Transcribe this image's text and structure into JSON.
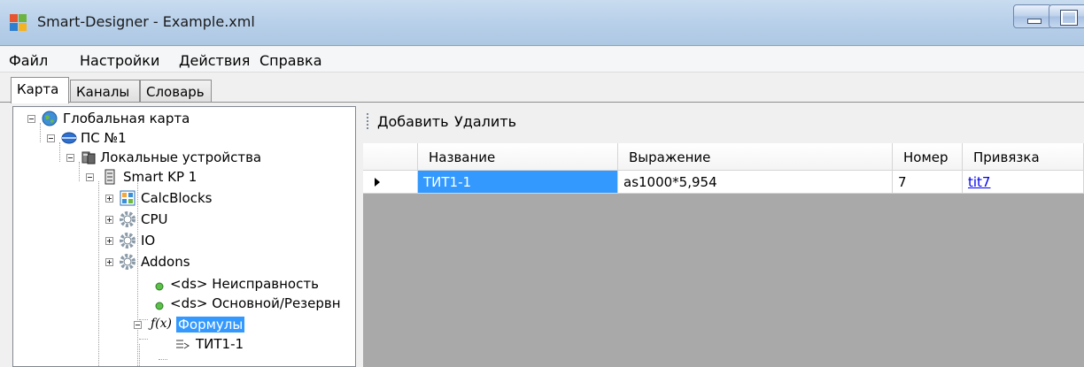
{
  "window": {
    "title": "Smart-Designer - Example.xml"
  },
  "menu": {
    "items": [
      "Файл",
      "Настройки",
      "Действия",
      "Справка"
    ]
  },
  "tabs": [
    "Карта",
    "Каналы",
    "Словарь"
  ],
  "tree": {
    "nodes": [
      {
        "label": "Глобальная карта",
        "icon": "globe-icon"
      },
      {
        "label": "ПС №1",
        "icon": "substation-icon"
      },
      {
        "label": "Локальные устройства",
        "icon": "devices-icon"
      },
      {
        "label": "Smart KP 1",
        "icon": "server-icon"
      },
      {
        "label": "CalcBlocks",
        "icon": "calcblocks-icon"
      },
      {
        "label": "CPU",
        "icon": "gear-icon"
      },
      {
        "label": "IO",
        "icon": "gear-icon"
      },
      {
        "label": "Addons",
        "icon": "gear-icon"
      },
      {
        "label": "<ds> Неисправность",
        "icon": "green-dot-icon"
      },
      {
        "label": "<ds> Основной/Резервн",
        "icon": "green-dot-icon"
      },
      {
        "label": "Формулы",
        "icon": "formula-icon"
      },
      {
        "label": "ТИТ1-1",
        "icon": "formula-item-icon"
      }
    ]
  },
  "toolbar": {
    "add_label": "Добавить",
    "delete_label": "Удалить"
  },
  "grid": {
    "columns": [
      "Название",
      "Выражение",
      "Номер",
      "Привязка"
    ],
    "rows": [
      {
        "name": "ТИТ1-1",
        "expression": "as1000*5,954",
        "number": "7",
        "binding": "tit7"
      }
    ]
  },
  "colors": {
    "selection": "#3399ff",
    "grid_background": "#a9a9a9"
  }
}
